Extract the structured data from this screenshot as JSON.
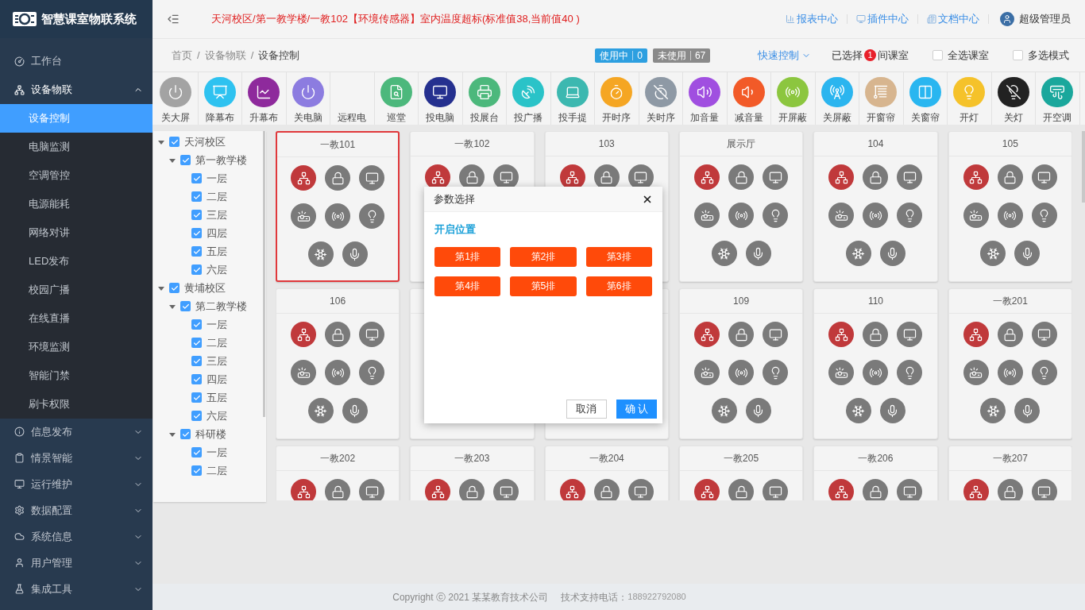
{
  "brand": {
    "title": "智慧课室物联系统"
  },
  "sidebar": {
    "menu": [
      {
        "label": "工作台"
      },
      {
        "label": "设备物联",
        "expanded": true,
        "children": [
          {
            "label": "设备控制",
            "selected": true
          },
          {
            "label": "电脑监测",
            "selected": false
          },
          {
            "label": "空调管控",
            "selected": false
          },
          {
            "label": "电源能耗",
            "selected": false
          },
          {
            "label": "网络对讲",
            "selected": false
          },
          {
            "label": "LED发布",
            "selected": false
          },
          {
            "label": "校园广播",
            "selected": false
          },
          {
            "label": "在线直播",
            "selected": false
          },
          {
            "label": "环境监测",
            "selected": false
          },
          {
            "label": "智能门禁",
            "selected": false
          },
          {
            "label": "刷卡权限",
            "selected": false
          }
        ]
      },
      {
        "label": "信息发布",
        "expanded": false
      },
      {
        "label": "情景智能",
        "expanded": false
      },
      {
        "label": "运行维护",
        "expanded": false
      },
      {
        "label": "数据配置",
        "expanded": false
      },
      {
        "label": "系统信息",
        "expanded": false
      },
      {
        "label": "用户管理",
        "expanded": false
      },
      {
        "label": "集成工具",
        "expanded": false
      }
    ]
  },
  "header": {
    "alert": "天河校区/第一教学楼/一教102【环境传感器】室内温度超标(标准值38,当前值40 )",
    "links": [
      "报表中心",
      "插件中心",
      "文档中心"
    ],
    "user": "超级管理员"
  },
  "breadcrumb": {
    "separator": "/",
    "items": [
      "首页",
      "设备物联",
      "设备控制"
    ]
  },
  "usage": [
    {
      "label": "使用中",
      "count": "0",
      "color": "#2d9fe0"
    },
    {
      "label": "未使用",
      "count": "67",
      "color": "#8a8a8a"
    }
  ],
  "quick_control": {
    "label": "快速控制"
  },
  "selection": {
    "prefix": "已选择",
    "count": "1",
    "suffix": "间课室"
  },
  "options": [
    {
      "label": "全选课室",
      "checked": false
    },
    {
      "label": "多选模式",
      "checked": false
    }
  ],
  "toolbar": [
    {
      "label": "关大屏",
      "color": "#a3a3a3"
    },
    {
      "label": "降幕布",
      "color": "#2ec2f0"
    },
    {
      "label": "升幕布",
      "color": "#8e2a9c"
    },
    {
      "label": "关电脑",
      "color": "#8c7ce0"
    },
    {
      "label": "远程电"
    },
    {
      "label": "巡堂",
      "color": "#4cb87c"
    },
    {
      "label": "投电脑",
      "color": "#25308f"
    },
    {
      "label": "投展台",
      "color": "#4cb87c"
    },
    {
      "label": "投广播",
      "color": "#2ac3c8"
    },
    {
      "label": "投手提",
      "color": "#3cb8b0"
    },
    {
      "label": "开时序",
      "color": "#f5a623"
    },
    {
      "label": "关时序",
      "color": "#8e99a5"
    },
    {
      "label": "加音量",
      "color": "#a04fe0"
    },
    {
      "label": "减音量",
      "color": "#f25a28"
    },
    {
      "label": "开屏蔽",
      "color": "#8cc63f"
    },
    {
      "label": "关屏蔽",
      "color": "#2bb5ef"
    },
    {
      "label": "开窗帘",
      "color": "#d7b58f"
    },
    {
      "label": "关窗帘",
      "color": "#29b6f0"
    },
    {
      "label": "开灯",
      "color": "#f5c22a"
    },
    {
      "label": "关灯",
      "color": "#222222"
    },
    {
      "label": "开空调",
      "color": "#1aa79c"
    }
  ],
  "tree": [
    {
      "label": "天河校区",
      "checked": true,
      "expanded": true,
      "children": [
        {
          "label": "第一教学楼",
          "checked": true,
          "expanded": true,
          "children": [
            {
              "label": "一层",
              "checked": true
            },
            {
              "label": "二层",
              "checked": true
            },
            {
              "label": "三层",
              "checked": true
            },
            {
              "label": "四层",
              "checked": true
            },
            {
              "label": "五层",
              "checked": true
            },
            {
              "label": "六层",
              "checked": true
            }
          ]
        }
      ]
    },
    {
      "label": "黄埔校区",
      "checked": true,
      "expanded": true,
      "children": [
        {
          "label": "第二教学楼",
          "checked": true,
          "expanded": true,
          "children": [
            {
              "label": "一层",
              "checked": true
            },
            {
              "label": "二层",
              "checked": true
            },
            {
              "label": "三层",
              "checked": true
            },
            {
              "label": "四层",
              "checked": true
            },
            {
              "label": "五层",
              "checked": true
            },
            {
              "label": "六层",
              "checked": true
            }
          ]
        },
        {
          "label": "科研楼",
          "checked": true,
          "expanded": true,
          "children": [
            {
              "label": "一层",
              "checked": true
            },
            {
              "label": "二层",
              "checked": true
            }
          ]
        }
      ]
    }
  ],
  "cards": [
    {
      "title": "一教101",
      "selected": true,
      "online": true
    },
    {
      "title": "一教102",
      "selected": false,
      "online": true
    },
    {
      "title": "103",
      "selected": false,
      "online": true
    },
    {
      "title": "展示厅",
      "selected": false,
      "online": true
    },
    {
      "title": "104",
      "selected": false,
      "online": true
    },
    {
      "title": "105",
      "selected": false,
      "online": true
    },
    {
      "title": "106",
      "selected": false,
      "online": true
    },
    {
      "selected": false
    },
    {
      "selected": false
    },
    {
      "title": "109",
      "selected": false,
      "online": true
    },
    {
      "title": "110",
      "selected": false,
      "online": true
    },
    {
      "title": "一教201",
      "selected": false,
      "online": true
    },
    {
      "title": "一教202",
      "selected": false,
      "online": true
    },
    {
      "title": "一教203",
      "selected": false,
      "online": true
    },
    {
      "title": "一教204",
      "selected": false,
      "online": true
    },
    {
      "title": "一教205",
      "selected": false,
      "online": true
    },
    {
      "title": "一教206",
      "selected": false,
      "online": true
    },
    {
      "title": "一教207",
      "selected": false,
      "online": true
    }
  ],
  "dialog": {
    "title": "参数选择",
    "section": "开启位置",
    "options": [
      "第1排",
      "第2排",
      "第3排",
      "第4排",
      "第5排",
      "第6排"
    ],
    "buttons": [
      {
        "label": "取消",
        "kind": "secondary"
      },
      {
        "label": "确 认",
        "kind": "primary"
      }
    ]
  },
  "footer": {
    "copyright": "Copyright ⓒ 2021 某某教育技术公司",
    "support_label": "技术支持电话：",
    "phone": "188922792080"
  }
}
